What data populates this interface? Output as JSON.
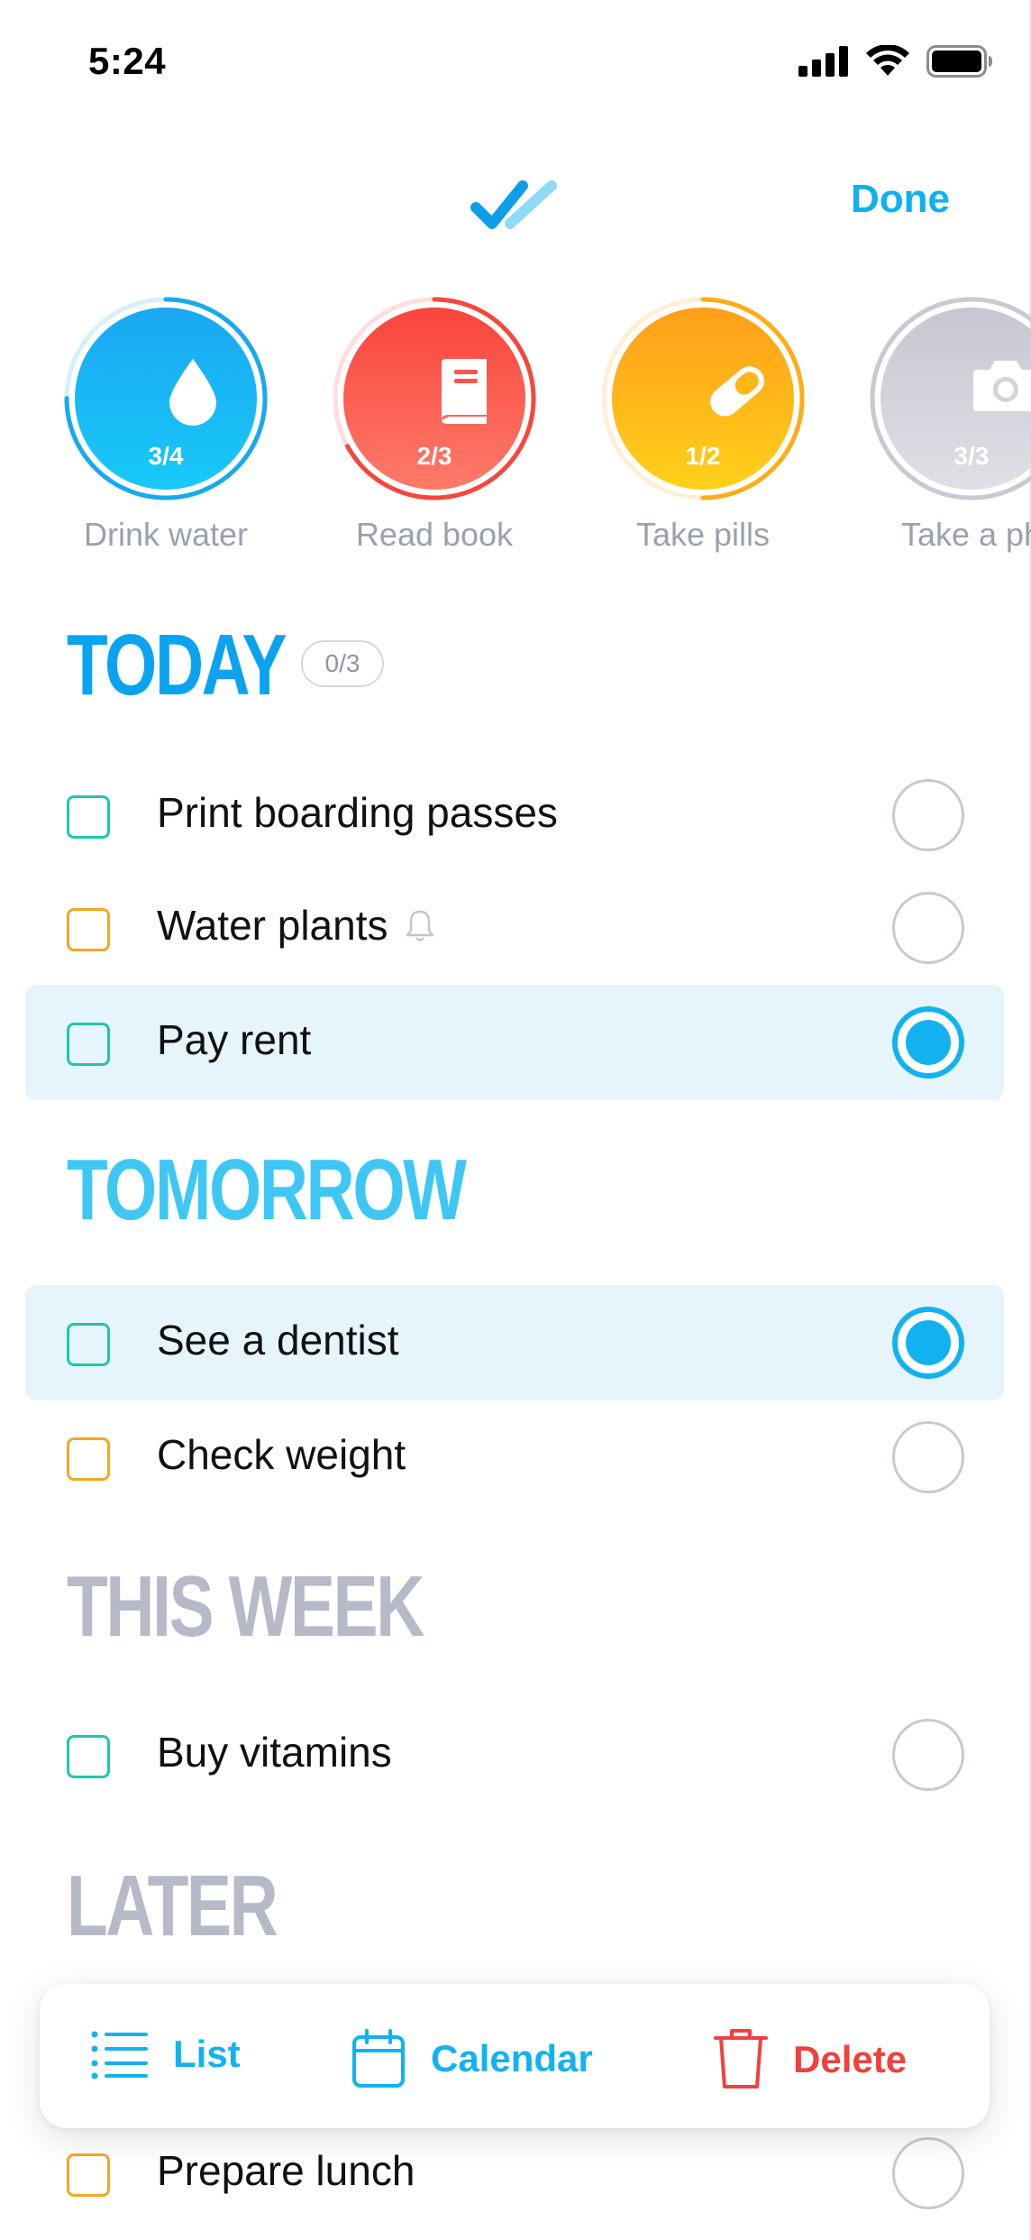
{
  "status_bar": {
    "time": "5:24"
  },
  "header": {
    "done_label": "Done"
  },
  "habits": [
    {
      "label": "Drink water",
      "count": "3/4",
      "progress": 0.75,
      "icon": "water-drop-icon",
      "color_top": "#1aa7f2",
      "color_bottom": "#18c9f8",
      "ring": "#17a9ef"
    },
    {
      "label": "Read book",
      "count": "2/3",
      "progress": 0.67,
      "icon": "book-icon",
      "color_top": "#f8453c",
      "color_bottom": "#ff7a6a",
      "ring": "#f5473d"
    },
    {
      "label": "Take pills",
      "count": "1/2",
      "progress": 0.5,
      "icon": "pill-icon",
      "color_top": "#ff9e1b",
      "color_bottom": "#ffd11a",
      "ring": "#ffac17"
    },
    {
      "label": "Take a ph",
      "count": "3/3",
      "progress": 1.0,
      "icon": "camera-icon",
      "color_top": "#c6c7d0",
      "color_bottom": "#dfe0e6",
      "ring": "#c8c9d2"
    }
  ],
  "sections": {
    "today": {
      "title": "TODAY",
      "badge": "0/3"
    },
    "tomorrow": {
      "title": "TOMORROW"
    },
    "this_week": {
      "title": "THIS WEEK"
    },
    "later": {
      "title": "LATER"
    }
  },
  "tasks": [
    {
      "text": "Print boarding passes",
      "color": "teal",
      "selected": false
    },
    {
      "text": "Water plants",
      "color": "orange",
      "selected": false,
      "reminder": true
    },
    {
      "text": "Pay rent",
      "color": "teal",
      "selected": true
    },
    {
      "text": "See a dentist",
      "color": "teal",
      "selected": true
    },
    {
      "text": "Check weight",
      "color": "orange",
      "selected": false
    },
    {
      "text": "Buy vitamins",
      "color": "teal",
      "selected": false
    },
    {
      "text": "Prepare lunch",
      "color": "orange",
      "selected": false
    }
  ],
  "actions": {
    "list": "List",
    "calendar": "Calendar",
    "delete": "Delete"
  },
  "colors": {
    "accent": "#12b2f1",
    "danger": "#f0413c",
    "teal": "#1fc7a9",
    "orange": "#f5a623"
  }
}
